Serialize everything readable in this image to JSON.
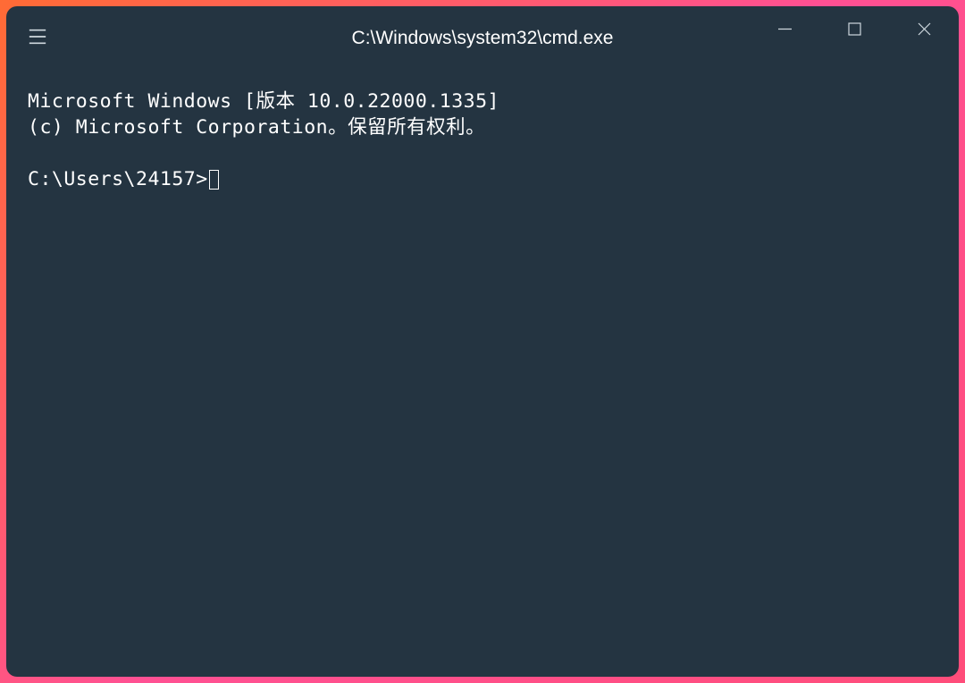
{
  "window": {
    "title": "C:\\Windows\\system32\\cmd.exe"
  },
  "terminal": {
    "line1": "Microsoft Windows [版本 10.0.22000.1335]",
    "line2": "(c) Microsoft Corporation。保留所有权利。",
    "blank": "",
    "prompt": "C:\\Users\\24157>"
  }
}
